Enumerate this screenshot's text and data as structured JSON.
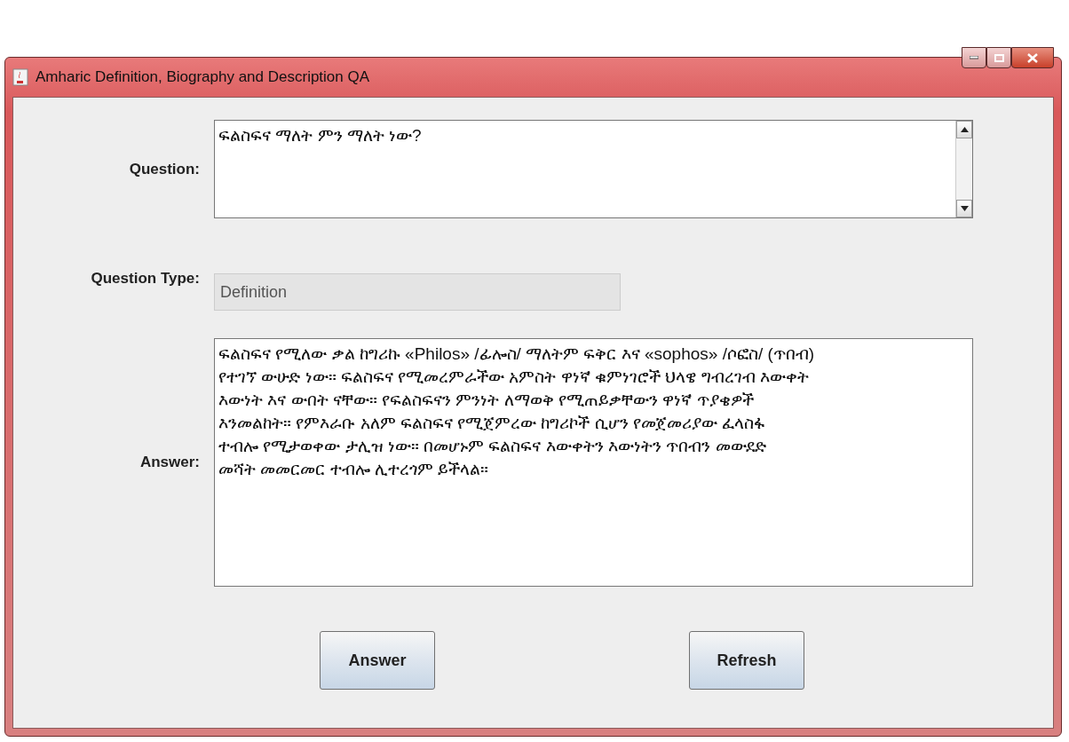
{
  "window": {
    "title": "Amharic Definition, Biography and Description QA"
  },
  "question": {
    "label": "Question:",
    "value": "ፍልስፍና ማለት ምን ማለት ነው?"
  },
  "question_type": {
    "label": "Question Type:",
    "value": "Definition",
    "disabled": true
  },
  "answer": {
    "label": "Answer:",
    "lines": [
      "ፍልስፍና የሚለው ቃል ከግሪኩ «Philos» /ፊሎስ/ ማለትም ፍቅር እና «sophos» /ሶፎስ/ (ጥበብ)",
      "የተገኘ ውሁድ ነው። ፍልስፍና የሚመረምራችው አምስት ዋነኛ ቁምነገሮች ህላዌ ግብረገብ እውቀት",
      "እውነት እና ውበት ናቸው። የፍልስፍናን ምንነት ለማወቅ የሚጠይቃቸውን ዋነኛ ጥያቄዎች",
      "እንመልከት። የምእራቡ አለም ፍልስፍና የሚጀምረው ከግሪኮች ሲሆን የመጀመሪያው ፈላስፋ",
      "ተብሎ የሚታወቀው ታሊዝ ነው። በመሆኑም ፍልስፍና እውቀትን እውነትን ጥበብን መውደድ",
      "መሻት መመርመር ተብሎ ሊተረጎም ይችላል።"
    ]
  },
  "buttons": [
    "Answer",
    "Refresh"
  ]
}
